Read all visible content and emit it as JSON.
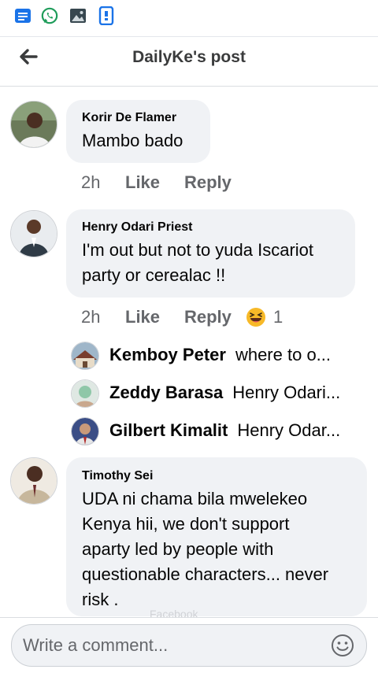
{
  "statusbar": {
    "icons": [
      "notes-icon",
      "whatsapp-icon",
      "gallery-icon",
      "phone-app-icon"
    ]
  },
  "header": {
    "title": "DailyKe's post",
    "back_icon": "arrow-left-icon"
  },
  "comments": [
    {
      "author": "Korir De Flamer",
      "text_lines": [
        "Mambo bado"
      ],
      "time": "2h",
      "like_label": "Like",
      "reply_label": "Reply"
    },
    {
      "author": "Henry Odari Priest",
      "text_lines": [
        "I'm out but not to yuda Iscariot",
        "party or cerealac !!"
      ],
      "time": "2h",
      "like_label": "Like",
      "reply_label": "Reply",
      "reaction": {
        "icon": "haha-emoji-icon",
        "count": "1"
      },
      "replies": [
        {
          "author": "Kemboy Peter",
          "preview": "where to o..."
        },
        {
          "author": "Zeddy Barasa",
          "preview": "Henry Odari..."
        },
        {
          "author": "Gilbert Kimalit",
          "preview": "Henry Odar..."
        }
      ]
    },
    {
      "author": "Timothy Sei",
      "text_lines": [
        "UDA ni chama bila mwelekeo",
        "Kenya hii, we don't support",
        "aparty led by people with",
        "questionable characters... never",
        "risk ."
      ]
    }
  ],
  "composer": {
    "placeholder": "Write a comment...",
    "emoji_icon": "smiley-icon"
  },
  "watermark": "Facebook",
  "colors": {
    "bubble": "#f0f2f5",
    "meta_text": "#65676b",
    "statusbar_blue": "#1a73e8",
    "whatsapp_green": "#25d366",
    "reaction_yellow": "#f7b928"
  }
}
